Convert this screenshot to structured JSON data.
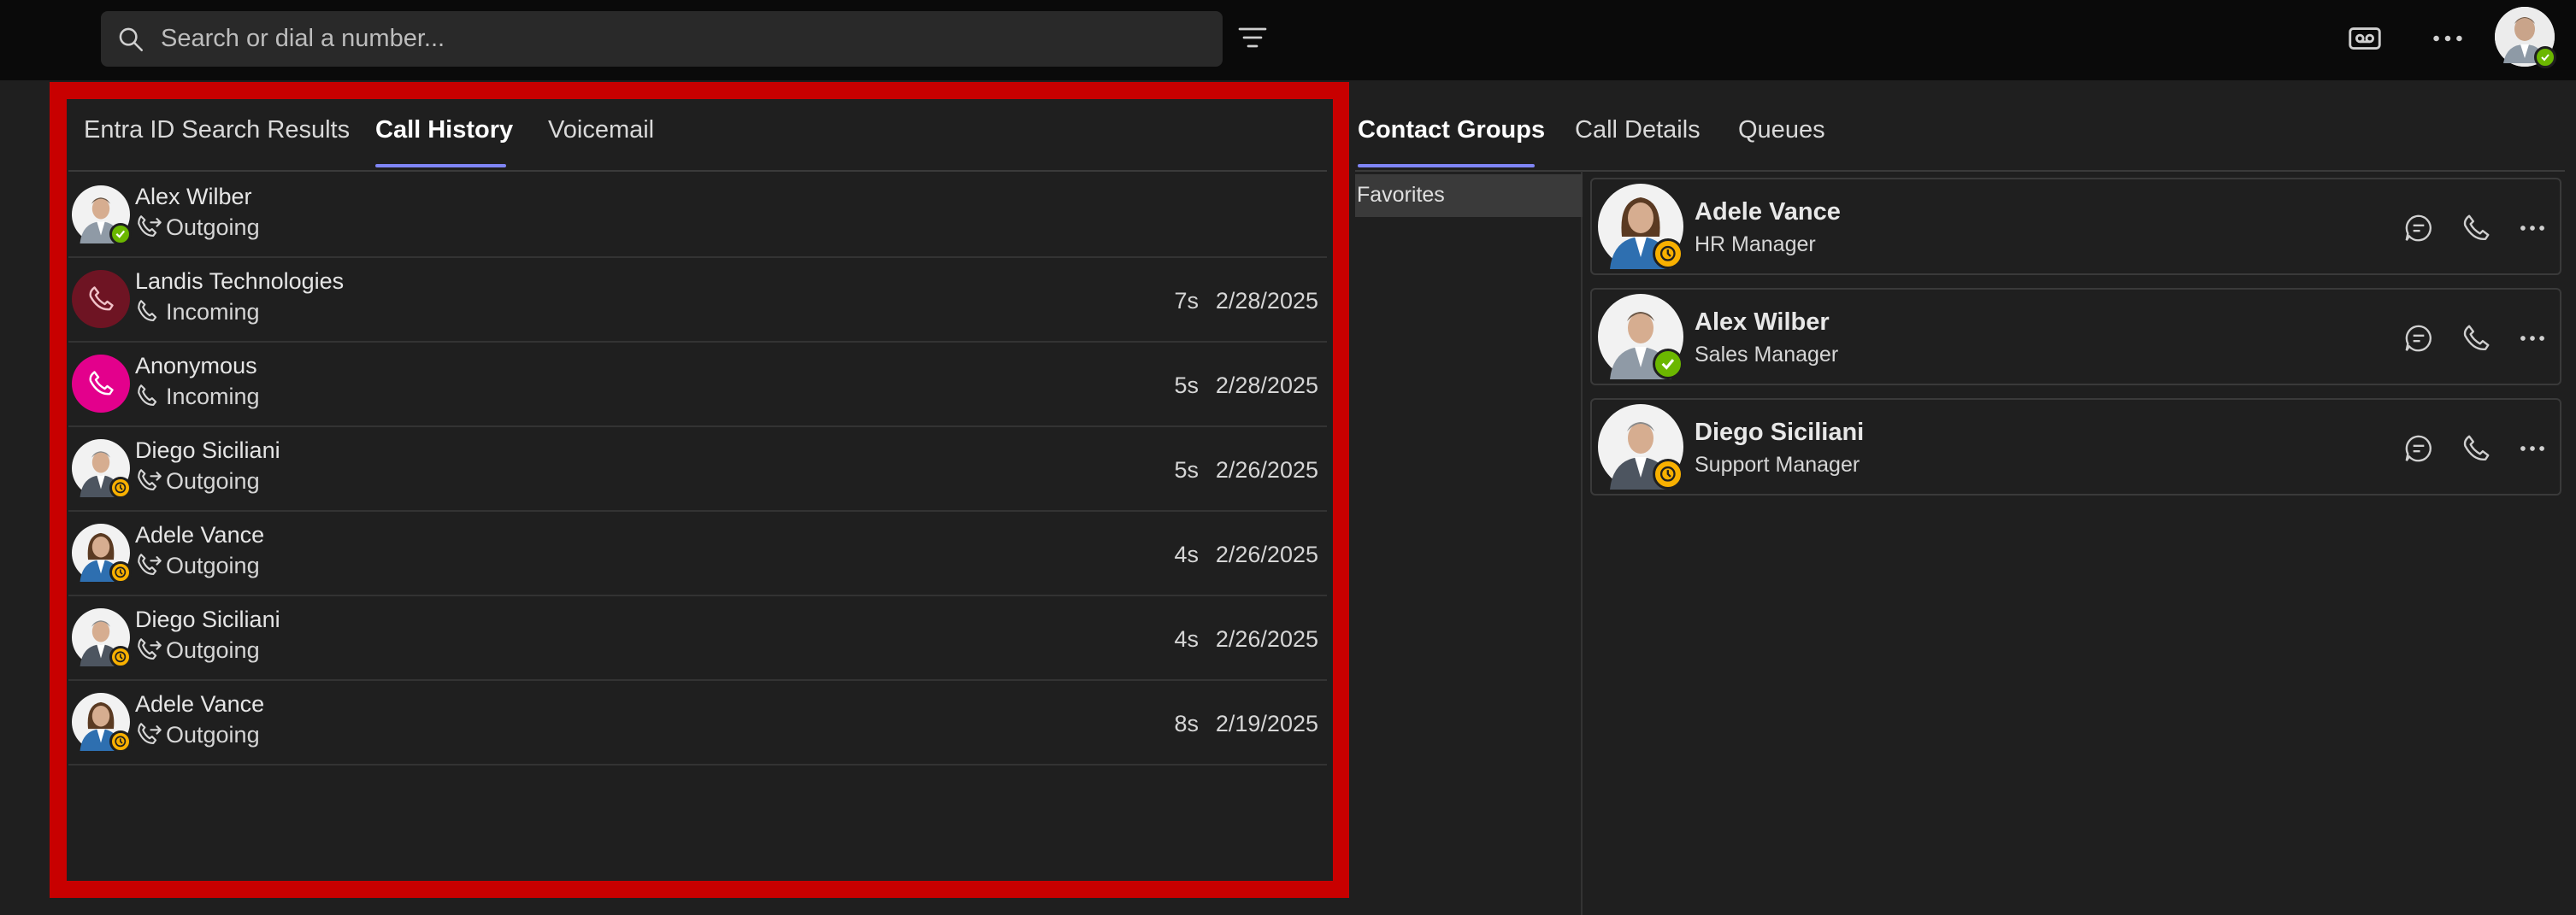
{
  "search": {
    "placeholder": "Search or dial a number..."
  },
  "left": {
    "tabs": [
      {
        "label": "Entra ID Search Results"
      },
      {
        "label": "Call History"
      },
      {
        "label": "Voicemail"
      }
    ],
    "active_tab": "Call History",
    "calls": [
      {
        "name": "Alex Wilber",
        "direction": "Outgoing",
        "duration": "",
        "date": "",
        "avatar": "photo",
        "status": "available"
      },
      {
        "name": "Landis Technologies",
        "direction": "Incoming",
        "duration": "7s",
        "date": "2/28/2025",
        "avatar": "phone-maroon",
        "status": ""
      },
      {
        "name": "Anonymous",
        "direction": "Incoming",
        "duration": "5s",
        "date": "2/28/2025",
        "avatar": "phone-magenta",
        "status": ""
      },
      {
        "name": "Diego Siciliani",
        "direction": "Outgoing",
        "duration": "5s",
        "date": "2/26/2025",
        "avatar": "photo",
        "status": "away"
      },
      {
        "name": "Adele Vance",
        "direction": "Outgoing",
        "duration": "4s",
        "date": "2/26/2025",
        "avatar": "photo",
        "status": "away"
      },
      {
        "name": "Diego Siciliani",
        "direction": "Outgoing",
        "duration": "4s",
        "date": "2/26/2025",
        "avatar": "photo",
        "status": "away"
      },
      {
        "name": "Adele Vance",
        "direction": "Outgoing",
        "duration": "8s",
        "date": "2/19/2025",
        "avatar": "photo",
        "status": "away"
      }
    ]
  },
  "right": {
    "tabs": [
      {
        "label": "Contact Groups"
      },
      {
        "label": "Call Details"
      },
      {
        "label": "Queues"
      }
    ],
    "active_tab": "Contact Groups",
    "groups": [
      {
        "label": "Favorites"
      }
    ],
    "contacts": [
      {
        "name": "Adele Vance",
        "title": "HR Manager",
        "status": "away"
      },
      {
        "name": "Alex Wilber",
        "title": "Sales Manager",
        "status": "available"
      },
      {
        "name": "Diego Siciliani",
        "title": "Support Manager",
        "status": "away"
      }
    ]
  },
  "colors": {
    "accent": "#7f85f5",
    "highlight_frame": "#c80000",
    "available": "#6bb700",
    "away": "#f8b000",
    "maroon_avatar": "#6e1423",
    "magenta_avatar": "#e3008c"
  },
  "icons": {
    "search": "search-icon",
    "filter": "filter-icon",
    "voicemail": "voicemail-icon",
    "more": "more-icon",
    "outgoing": "outgoing-call-icon",
    "incoming": "incoming-call-icon",
    "chat": "chat-icon",
    "call": "call-icon"
  }
}
